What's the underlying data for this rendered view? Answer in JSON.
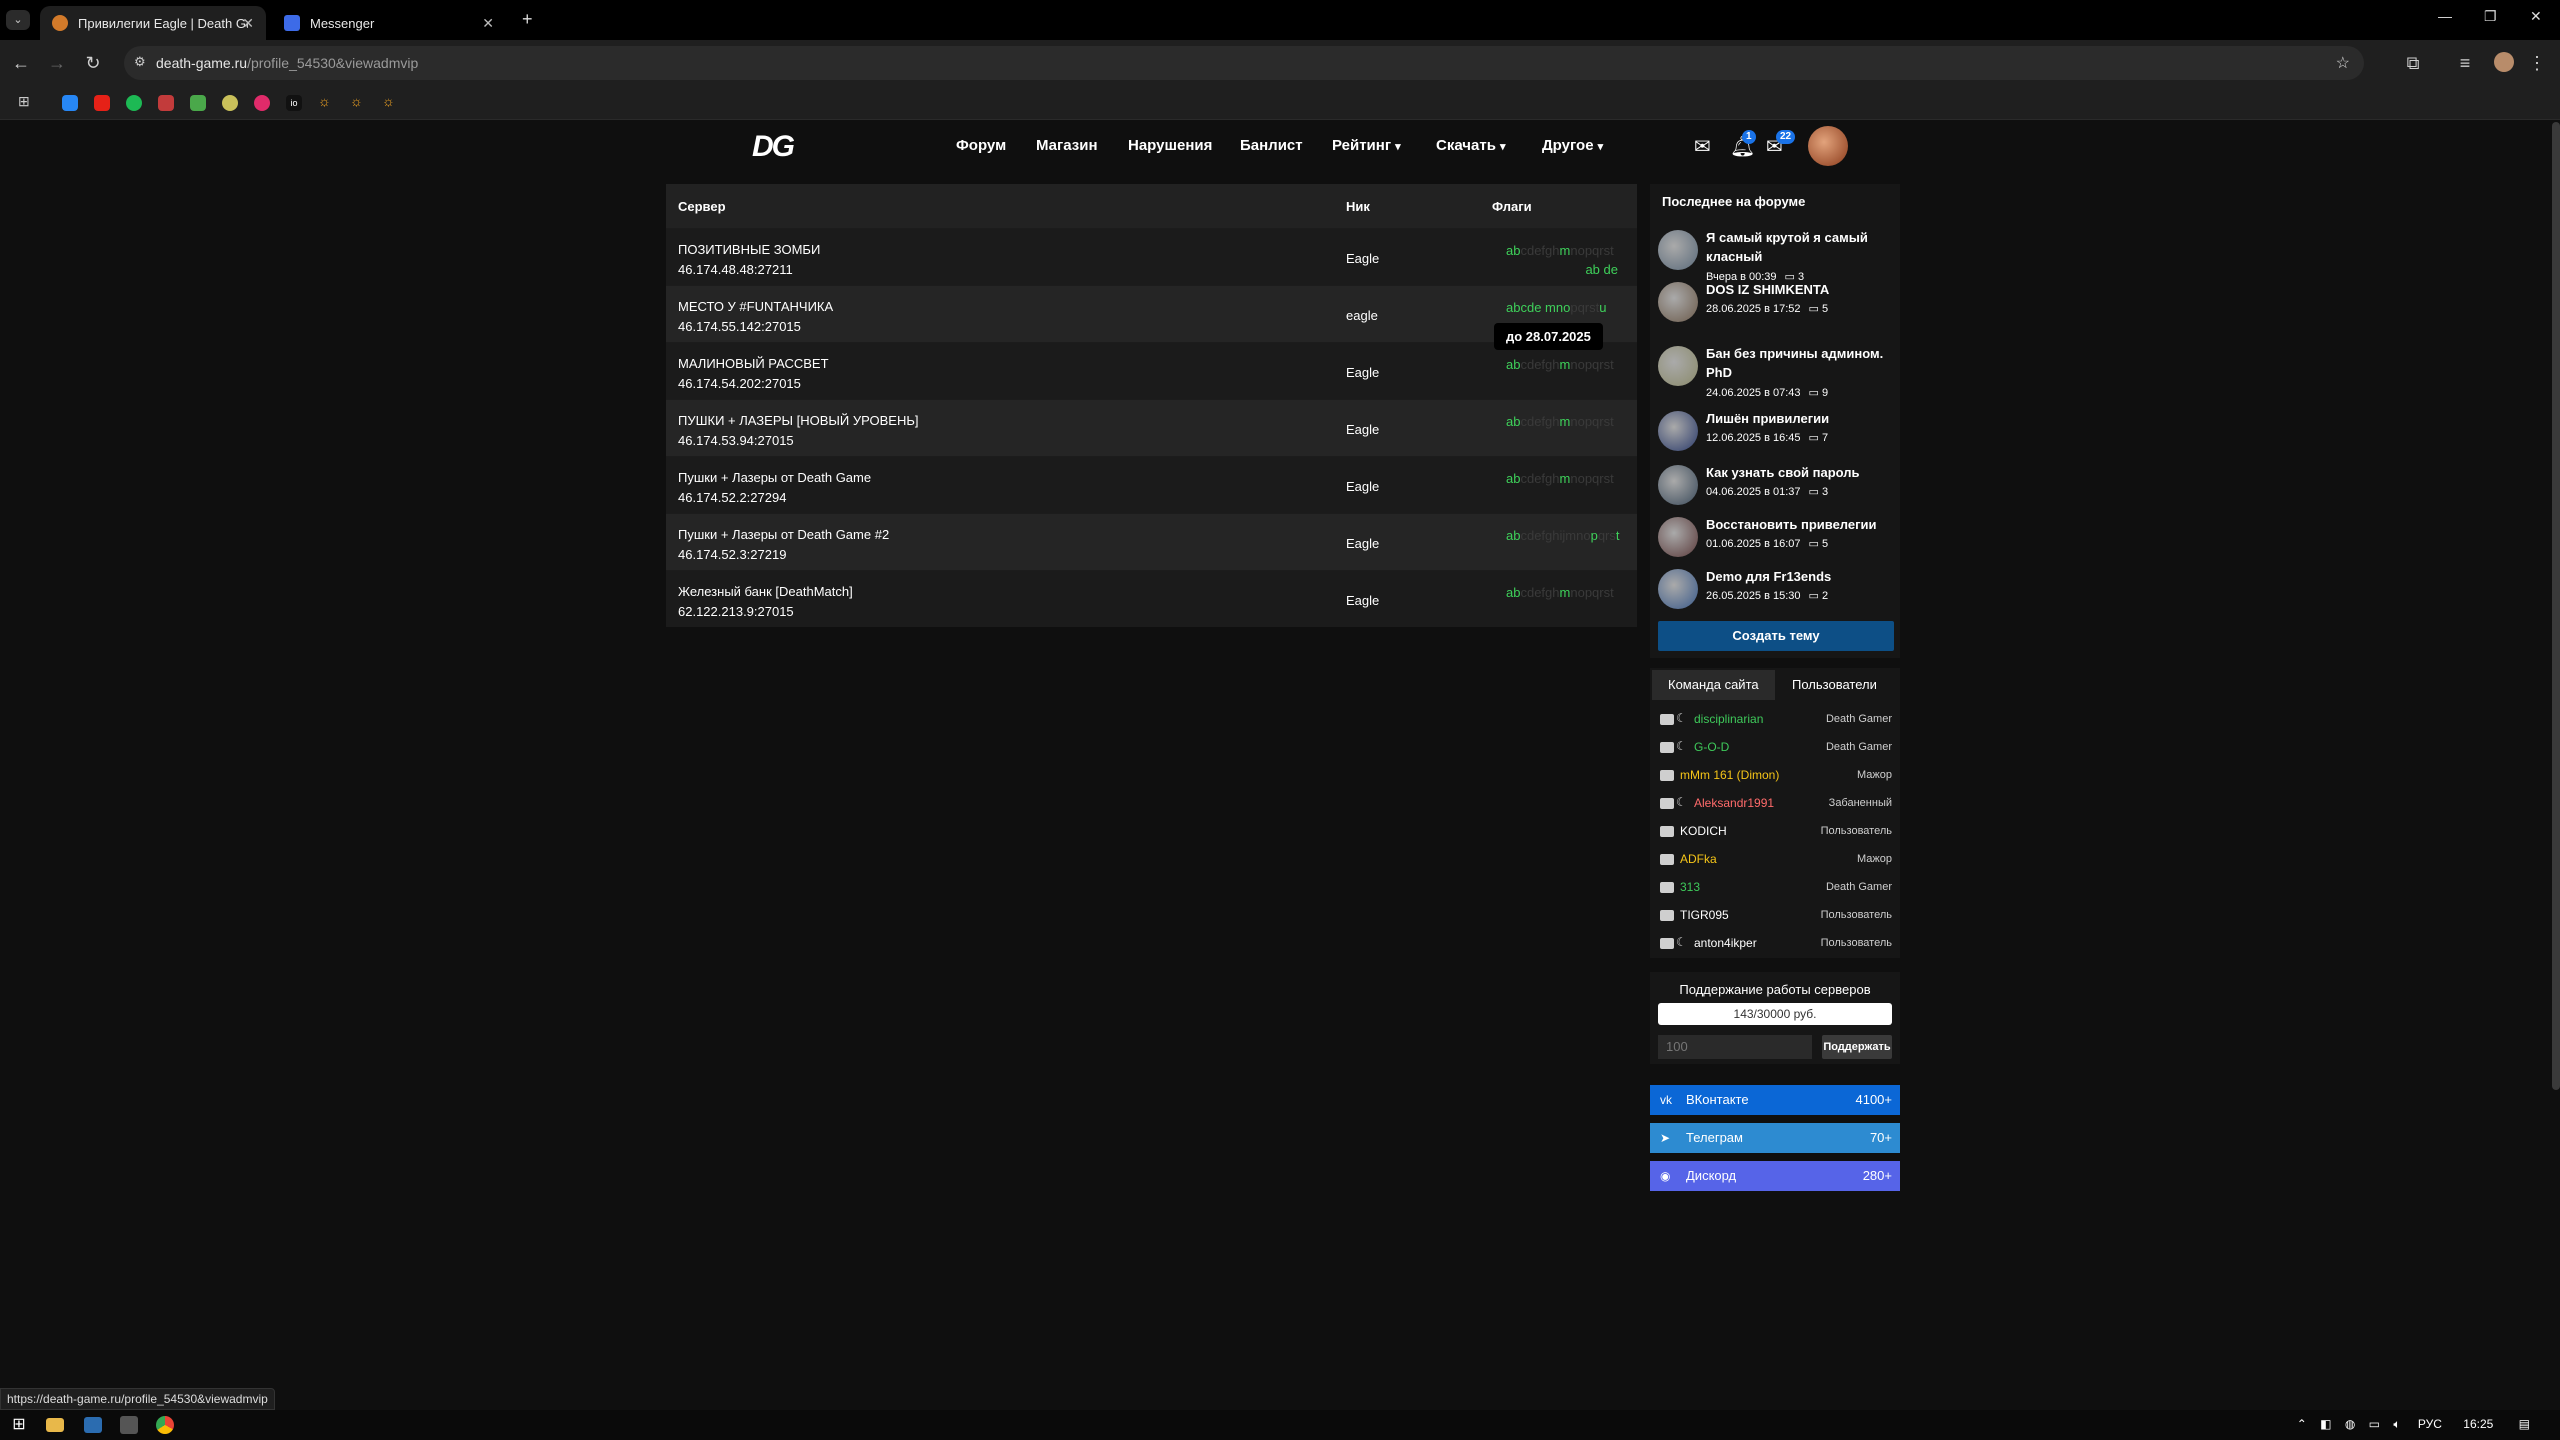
{
  "browser": {
    "tabs": [
      {
        "title": "Привилегии Eagle | Death Game",
        "active": true
      },
      {
        "title": "Messenger",
        "active": false
      }
    ],
    "url_host": "death-game.ru",
    "url_path": "/profile_54530&viewadmvip",
    "status_url": "https://death-game.ru/profile_54530&viewadmvip"
  },
  "site": {
    "logo": "DG",
    "nav": [
      {
        "label": "Форум",
        "dropdown": false
      },
      {
        "label": "Магазин",
        "dropdown": false
      },
      {
        "label": "Нарушения",
        "dropdown": false
      },
      {
        "label": "Банлист",
        "dropdown": false
      },
      {
        "label": "Рейтинг",
        "dropdown": true
      },
      {
        "label": "Скачать",
        "dropdown": true
      },
      {
        "label": "Другое",
        "dropdown": true
      }
    ],
    "notif_count": "1",
    "mail_count": "22"
  },
  "table": {
    "headers": {
      "server": "Сервер",
      "nick": "Ник",
      "flags": "Флаги"
    },
    "rows": [
      {
        "name": "ПОЗИТИВНЫЕ ЗОМБИ",
        "ip": "46.174.48.48:27211",
        "nick": "Eagle",
        "flags_active": [
          "ab",
          "m"
        ],
        "flags_line2": "ab de"
      },
      {
        "name": "МЕСТО У #FUNТАНЧИКА",
        "ip": "46.174.55.142:27015",
        "nick": "eagle",
        "flags_active": [
          "abcde",
          "mno",
          "u"
        ],
        "flags_line2": ""
      },
      {
        "name": "МАЛИНОВЫЙ РАССВЕТ",
        "ip": "46.174.54.202:27015",
        "nick": "Eagle",
        "flags_active": [
          "ab",
          "m"
        ],
        "flags_line2": ""
      },
      {
        "name": "ПУШКИ + ЛАЗЕРЫ [НОВЫЙ УРОВЕНЬ]",
        "ip": "46.174.53.94:27015",
        "nick": "Eagle",
        "flags_active": [
          "ab",
          "m"
        ],
        "flags_line2": ""
      },
      {
        "name": "Пушки + Лазеры от Death Game",
        "ip": "46.174.52.2:27294",
        "nick": "Eagle",
        "flags_active": [
          "ab",
          "m"
        ],
        "flags_line2": ""
      },
      {
        "name": "Пушки + Лазеры от Death Game #2",
        "ip": "46.174.52.3:27219",
        "nick": "Eagle",
        "flags_active": [
          "ab",
          "p",
          "t"
        ],
        "flags_line2": ""
      },
      {
        "name": "Железный банк [DeathMatch]",
        "ip": "62.122.213.9:27015",
        "nick": "Eagle",
        "flags_active": [
          "ab",
          "m"
        ],
        "flags_line2": ""
      }
    ],
    "tooltip": "до 28.07.2025"
  },
  "forum": {
    "title": "Последнее на форуме",
    "posts": [
      {
        "title": "Я самый крутой я самый класный",
        "date": "Вчера в 00:39",
        "comments": "3"
      },
      {
        "title": "DOS IZ SHIMKENTA",
        "date": "28.06.2025 в 17:52",
        "comments": "5"
      },
      {
        "title": "Бан без причины админом. PhD",
        "date": "24.06.2025 в 07:43",
        "comments": "9"
      },
      {
        "title": "Лишён привилегии",
        "date": "12.06.2025 в 16:45",
        "comments": "7"
      },
      {
        "title": "Как узнать свой пароль",
        "date": "04.06.2025 в 01:37",
        "comments": "3"
      },
      {
        "title": "Восстановить привелегии",
        "date": "01.06.2025 в 16:07",
        "comments": "5"
      },
      {
        "title": "Demo для Fr13ends",
        "date": "26.05.2025 в 15:30",
        "comments": "2"
      }
    ],
    "create_button": "Создать тему"
  },
  "team": {
    "tabs": [
      "Команда сайта",
      "Пользователи"
    ],
    "members": [
      {
        "name": "disciplinarian",
        "role": "Death Gamer",
        "color": "#3ec95a",
        "moon": true
      },
      {
        "name": "G-O-D",
        "role": "Death Gamer",
        "color": "#3ec95a",
        "moon": true
      },
      {
        "name": "mMm 161 (Dimon)",
        "role": "Мажор",
        "color": "#f5c518",
        "moon": false
      },
      {
        "name": "Aleksandr1991",
        "role": "Забаненный",
        "color": "#ff6b6b",
        "moon": true
      },
      {
        "name": "KODICH",
        "role": "Пользователь",
        "color": "#ffffff",
        "moon": false
      },
      {
        "name": "ADFka",
        "role": "Мажор",
        "color": "#f5c518",
        "moon": false
      },
      {
        "name": "313",
        "role": "Death Gamer",
        "color": "#3ec95a",
        "moon": false
      },
      {
        "name": "TIGR095",
        "role": "Пользователь",
        "color": "#ffffff",
        "moon": false
      },
      {
        "name": "anton4ikper",
        "role": "Пользователь",
        "color": "#ffffff",
        "moon": true
      }
    ]
  },
  "support": {
    "title": "Поддержание работы серверов",
    "progress": "143/30000 руб.",
    "input_placeholder": "100",
    "button": "Поддержать"
  },
  "social": [
    {
      "label": "ВКонтакте",
      "count": "4100+",
      "color": "#0b67d6",
      "icon": "vk-icon"
    },
    {
      "label": "Телеграм",
      "count": "70+",
      "color": "#2d8bd1",
      "icon": "telegram-icon"
    },
    {
      "label": "Дискорд",
      "count": "280+",
      "color": "#5664e8",
      "icon": "discord-icon"
    }
  ],
  "tray": {
    "lang": "РУС",
    "time": "16:25"
  }
}
